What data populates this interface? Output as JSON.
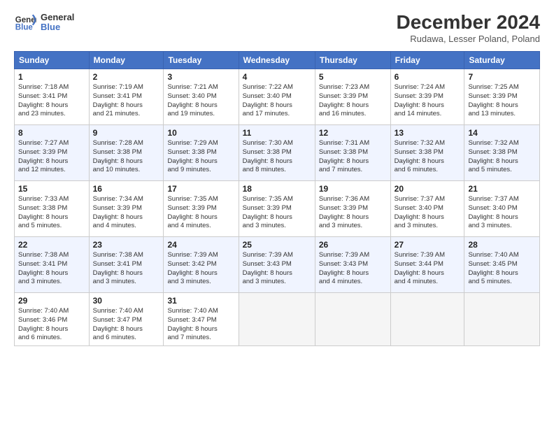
{
  "header": {
    "logo_text_line1": "General",
    "logo_text_line2": "Blue",
    "month": "December 2024",
    "location": "Rudawa, Lesser Poland, Poland"
  },
  "weekdays": [
    "Sunday",
    "Monday",
    "Tuesday",
    "Wednesday",
    "Thursday",
    "Friday",
    "Saturday"
  ],
  "weeks": [
    [
      {
        "day": "1",
        "info": "Sunrise: 7:18 AM\nSunset: 3:41 PM\nDaylight: 8 hours\nand 23 minutes."
      },
      {
        "day": "2",
        "info": "Sunrise: 7:19 AM\nSunset: 3:41 PM\nDaylight: 8 hours\nand 21 minutes."
      },
      {
        "day": "3",
        "info": "Sunrise: 7:21 AM\nSunset: 3:40 PM\nDaylight: 8 hours\nand 19 minutes."
      },
      {
        "day": "4",
        "info": "Sunrise: 7:22 AM\nSunset: 3:40 PM\nDaylight: 8 hours\nand 17 minutes."
      },
      {
        "day": "5",
        "info": "Sunrise: 7:23 AM\nSunset: 3:39 PM\nDaylight: 8 hours\nand 16 minutes."
      },
      {
        "day": "6",
        "info": "Sunrise: 7:24 AM\nSunset: 3:39 PM\nDaylight: 8 hours\nand 14 minutes."
      },
      {
        "day": "7",
        "info": "Sunrise: 7:25 AM\nSunset: 3:39 PM\nDaylight: 8 hours\nand 13 minutes."
      }
    ],
    [
      {
        "day": "8",
        "info": "Sunrise: 7:27 AM\nSunset: 3:39 PM\nDaylight: 8 hours\nand 12 minutes."
      },
      {
        "day": "9",
        "info": "Sunrise: 7:28 AM\nSunset: 3:38 PM\nDaylight: 8 hours\nand 10 minutes."
      },
      {
        "day": "10",
        "info": "Sunrise: 7:29 AM\nSunset: 3:38 PM\nDaylight: 8 hours\nand 9 minutes."
      },
      {
        "day": "11",
        "info": "Sunrise: 7:30 AM\nSunset: 3:38 PM\nDaylight: 8 hours\nand 8 minutes."
      },
      {
        "day": "12",
        "info": "Sunrise: 7:31 AM\nSunset: 3:38 PM\nDaylight: 8 hours\nand 7 minutes."
      },
      {
        "day": "13",
        "info": "Sunrise: 7:32 AM\nSunset: 3:38 PM\nDaylight: 8 hours\nand 6 minutes."
      },
      {
        "day": "14",
        "info": "Sunrise: 7:32 AM\nSunset: 3:38 PM\nDaylight: 8 hours\nand 5 minutes."
      }
    ],
    [
      {
        "day": "15",
        "info": "Sunrise: 7:33 AM\nSunset: 3:38 PM\nDaylight: 8 hours\nand 5 minutes."
      },
      {
        "day": "16",
        "info": "Sunrise: 7:34 AM\nSunset: 3:39 PM\nDaylight: 8 hours\nand 4 minutes."
      },
      {
        "day": "17",
        "info": "Sunrise: 7:35 AM\nSunset: 3:39 PM\nDaylight: 8 hours\nand 4 minutes."
      },
      {
        "day": "18",
        "info": "Sunrise: 7:35 AM\nSunset: 3:39 PM\nDaylight: 8 hours\nand 3 minutes."
      },
      {
        "day": "19",
        "info": "Sunrise: 7:36 AM\nSunset: 3:39 PM\nDaylight: 8 hours\nand 3 minutes."
      },
      {
        "day": "20",
        "info": "Sunrise: 7:37 AM\nSunset: 3:40 PM\nDaylight: 8 hours\nand 3 minutes."
      },
      {
        "day": "21",
        "info": "Sunrise: 7:37 AM\nSunset: 3:40 PM\nDaylight: 8 hours\nand 3 minutes."
      }
    ],
    [
      {
        "day": "22",
        "info": "Sunrise: 7:38 AM\nSunset: 3:41 PM\nDaylight: 8 hours\nand 3 minutes."
      },
      {
        "day": "23",
        "info": "Sunrise: 7:38 AM\nSunset: 3:41 PM\nDaylight: 8 hours\nand 3 minutes."
      },
      {
        "day": "24",
        "info": "Sunrise: 7:39 AM\nSunset: 3:42 PM\nDaylight: 8 hours\nand 3 minutes."
      },
      {
        "day": "25",
        "info": "Sunrise: 7:39 AM\nSunset: 3:43 PM\nDaylight: 8 hours\nand 3 minutes."
      },
      {
        "day": "26",
        "info": "Sunrise: 7:39 AM\nSunset: 3:43 PM\nDaylight: 8 hours\nand 4 minutes."
      },
      {
        "day": "27",
        "info": "Sunrise: 7:39 AM\nSunset: 3:44 PM\nDaylight: 8 hours\nand 4 minutes."
      },
      {
        "day": "28",
        "info": "Sunrise: 7:40 AM\nSunset: 3:45 PM\nDaylight: 8 hours\nand 5 minutes."
      }
    ],
    [
      {
        "day": "29",
        "info": "Sunrise: 7:40 AM\nSunset: 3:46 PM\nDaylight: 8 hours\nand 6 minutes."
      },
      {
        "day": "30",
        "info": "Sunrise: 7:40 AM\nSunset: 3:47 PM\nDaylight: 8 hours\nand 6 minutes."
      },
      {
        "day": "31",
        "info": "Sunrise: 7:40 AM\nSunset: 3:47 PM\nDaylight: 8 hours\nand 7 minutes."
      },
      {
        "day": "",
        "info": ""
      },
      {
        "day": "",
        "info": ""
      },
      {
        "day": "",
        "info": ""
      },
      {
        "day": "",
        "info": ""
      }
    ]
  ]
}
